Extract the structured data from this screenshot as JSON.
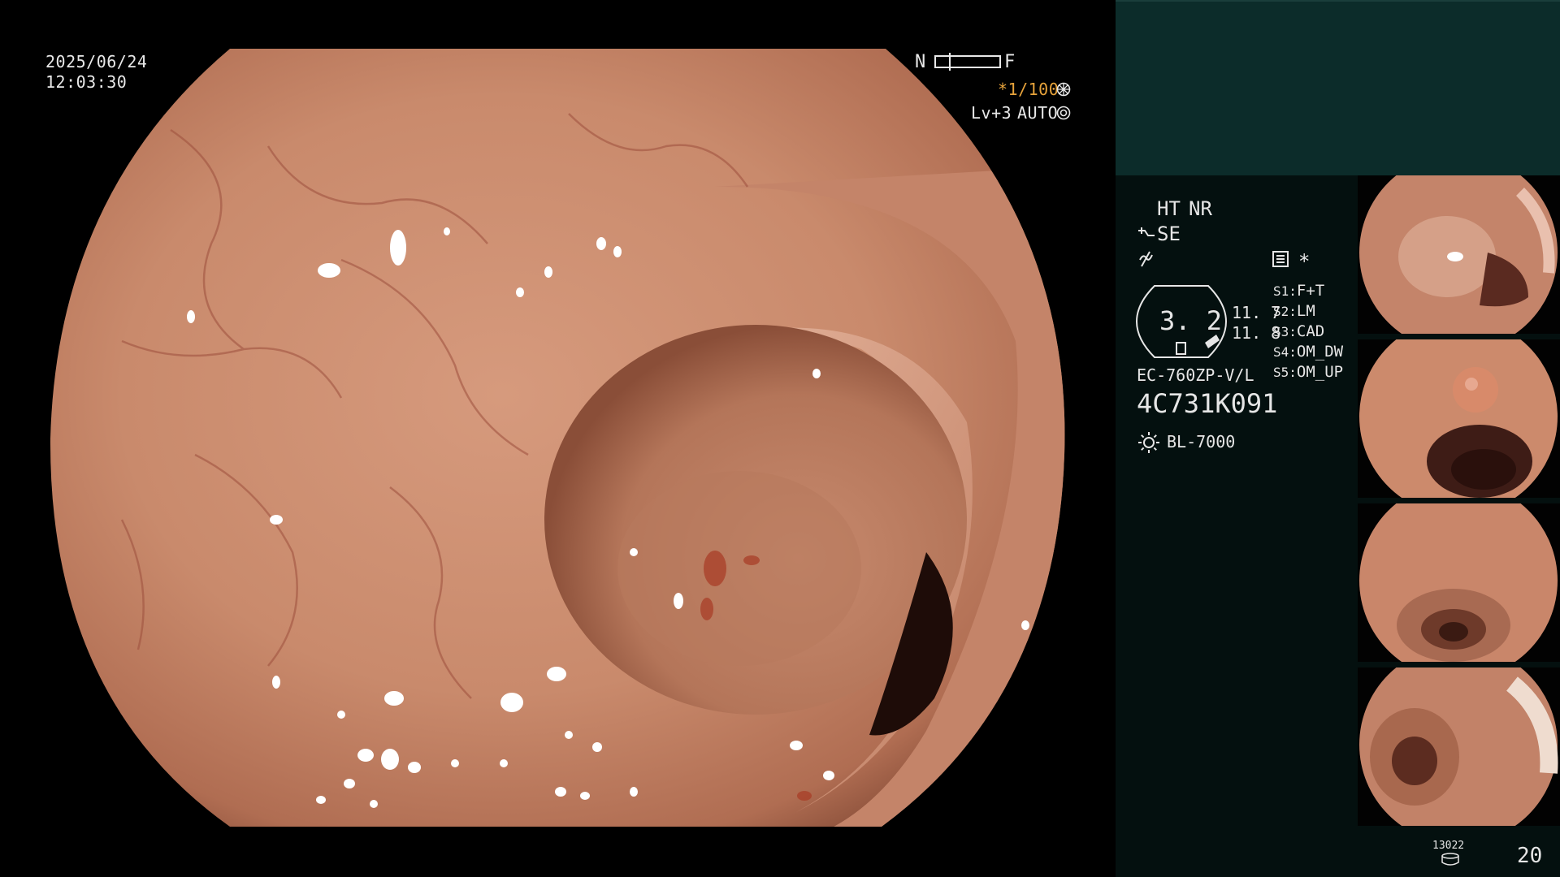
{
  "overlay": {
    "date": "2025/06/24",
    "time": "12:03:30",
    "distance_near": "N",
    "distance_far": "F",
    "shutter": "*1/100",
    "iris": "Lv+3",
    "iris_mode": "AUTO"
  },
  "panel": {
    "ht": "HT",
    "nr": "NR",
    "se": "SE",
    "asterisk": "*",
    "zoom_value": "3. 2",
    "zoom_upper": "11. 7",
    "zoom_lower": "11. 8",
    "scope_model": "EC-760ZP-V/L",
    "scope_serial": "4C731K091",
    "light_source": "BL-7000",
    "switches": [
      {
        "key": "S1",
        "value": "F+T"
      },
      {
        "key": "S2",
        "value": "LM"
      },
      {
        "key": "S3",
        "value": "CAD"
      },
      {
        "key": "S4",
        "value": "OM_DW"
      },
      {
        "key": "S5",
        "value": "OM_UP"
      }
    ],
    "storage_count": "13022",
    "image_count": "20"
  },
  "thumbnails": [
    {
      "label": "thumbnail-1"
    },
    {
      "label": "thumbnail-2"
    },
    {
      "label": "thumbnail-3"
    },
    {
      "label": "thumbnail-4"
    }
  ],
  "colors": {
    "accent_orange": "#e7a33b",
    "panel_top": "#0c2c2a",
    "panel_body": "#04100f",
    "mucosa": "#c98a6e"
  },
  "icons": [
    "aperture-icon",
    "focus-icon",
    "scope-connector-icon",
    "lightning-icon",
    "recorder-icon",
    "light-bulb-icon",
    "storage-icon"
  ]
}
